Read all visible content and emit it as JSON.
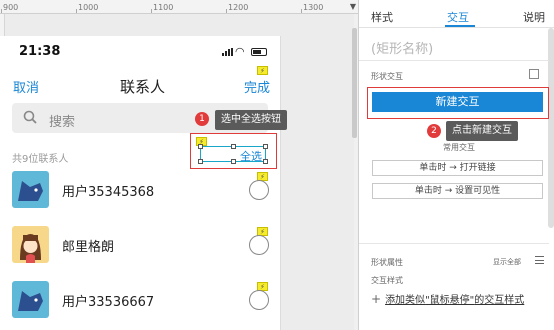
{
  "ruler": {
    "ticks": [
      "900",
      "1000",
      "1100",
      "1200",
      "1300"
    ]
  },
  "phone": {
    "time": "21:38",
    "nav": {
      "left": "取消",
      "title": "联系人",
      "right": "完成"
    },
    "search_placeholder": "搜索",
    "count_label": "共9位联系人",
    "select_all": "全选",
    "contacts": [
      {
        "name": "用户35345368",
        "avatar": "dog-avatar"
      },
      {
        "name": "郎里格朗",
        "avatar": "girl-avatar"
      },
      {
        "name": "用户33536667",
        "avatar": "dog-avatar"
      }
    ],
    "flag_icon": "lightning-icon"
  },
  "annotations": [
    {
      "number": "1",
      "text": "选中全选按钮"
    },
    {
      "number": "2",
      "text": "点击新建交互"
    }
  ],
  "panel": {
    "tabs": [
      "样式",
      "交互",
      "说明"
    ],
    "active_tab": "交互",
    "shape_name_placeholder": "(矩形名称)",
    "shape_interaction_label": "形状交互",
    "new_interaction_button": "新建交互",
    "common_label": "常用交互",
    "options": [
      "单击时 → 打开链接",
      "单击时 → 设置可见性"
    ],
    "shape_props_label": "形状属性",
    "show_all": "显示全部",
    "interaction_style_label": "交互样式",
    "add_style_prefix": "添加类似",
    "add_style_link": "\"鼠标悬停\"",
    "add_style_suffix": "的交互样式"
  },
  "colors": {
    "accent": "#1a86d6",
    "annotation_red": "#e23b3b",
    "tooltip_bg": "#5a5a5a"
  }
}
